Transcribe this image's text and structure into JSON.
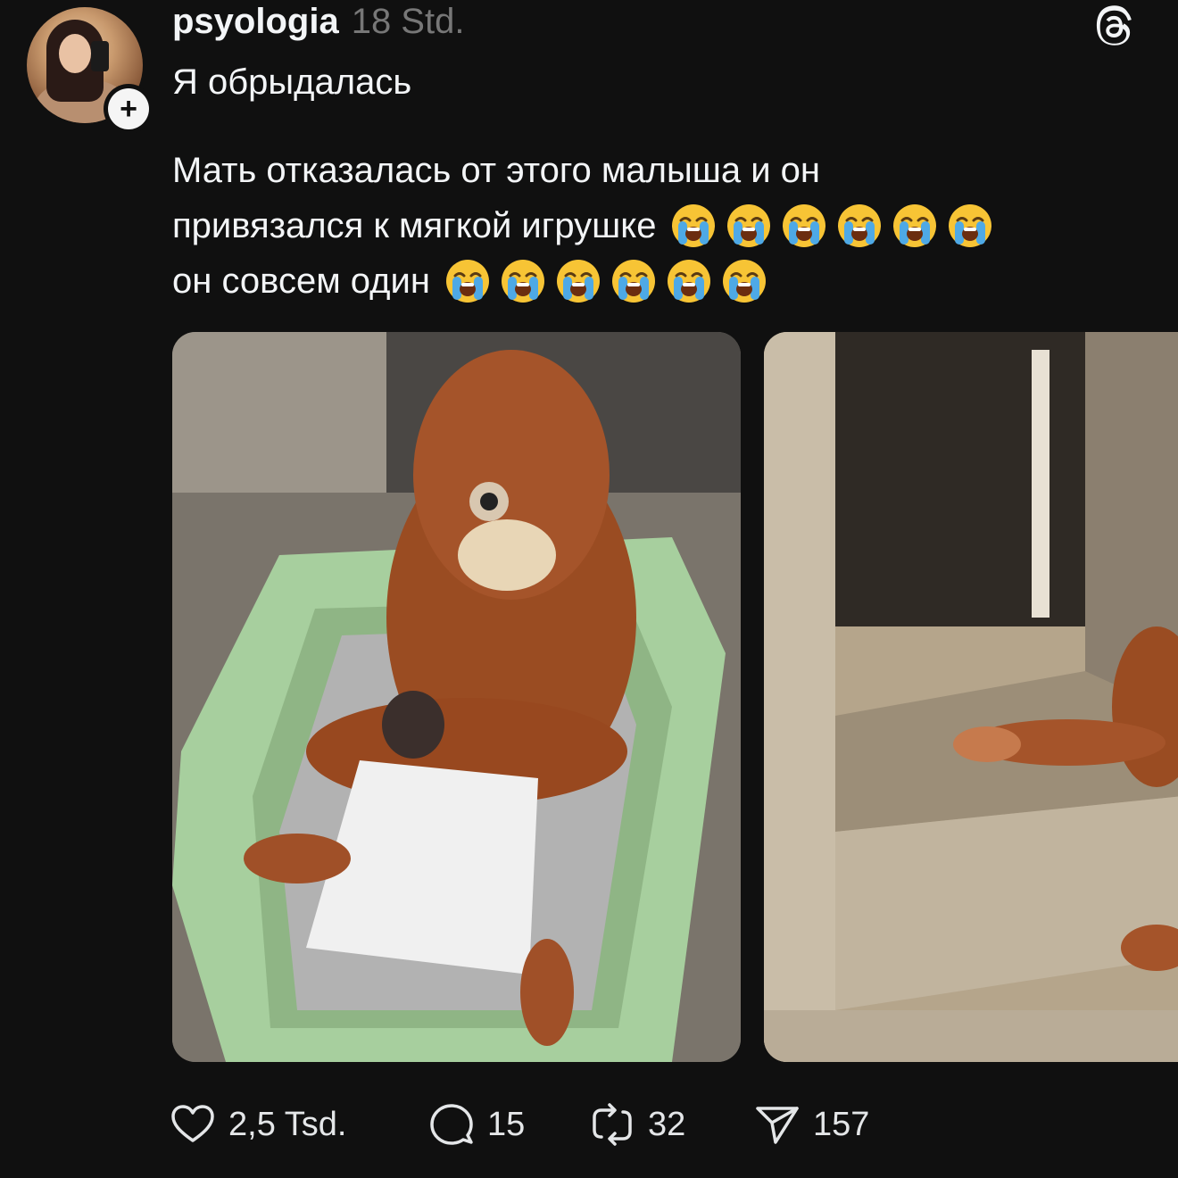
{
  "post": {
    "username": "psyologia",
    "time": "18 Std.",
    "line1": "Я обрыдалась",
    "body_lines": [
      {
        "text": "Мать отказалась от этого малыша и он",
        "emoji_count": 0
      },
      {
        "text": "привязался к мягкой игрушке",
        "emoji_count": 6
      },
      {
        "text": "он совсем один",
        "emoji_count": 6
      }
    ],
    "emoji": "loudly-crying-face"
  },
  "icons": {
    "avatar": "avatar-photo",
    "follow": "plus-icon",
    "logo": "threads-logo-icon",
    "like": "heart-icon",
    "reply": "comment-icon",
    "repost": "repost-icon",
    "share": "send-icon"
  },
  "actions": {
    "likes": "2,5 Tsd.",
    "replies": "15",
    "reposts": "32",
    "shares": "157"
  },
  "colors": {
    "background": "#101010",
    "text": "#f3f5f7",
    "muted": "#777777"
  }
}
